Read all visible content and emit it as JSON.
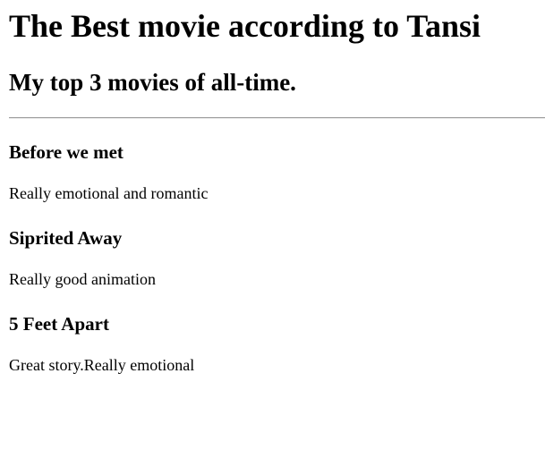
{
  "page": {
    "title": "The Best movie according to Tansi",
    "subtitle": "My top 3 movies of all-time."
  },
  "movies": [
    {
      "title": "Before we met",
      "description": "Really emotional and romantic"
    },
    {
      "title": "Siprited Away",
      "description": "Really good animation"
    },
    {
      "title": "5 Feet Apart",
      "description": "Great story.Really emotional"
    }
  ]
}
